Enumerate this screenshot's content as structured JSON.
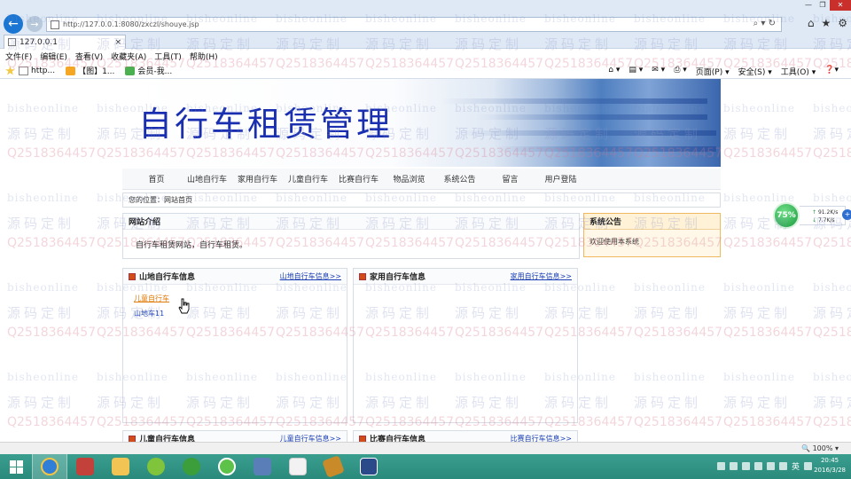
{
  "browser": {
    "address": "http://127.0.0.1:8080/zxczl/shouye.jsp",
    "tab_title": "127.0.0.1",
    "tab_close": "×",
    "menu": [
      "文件(F)",
      "编辑(E)",
      "查看(V)",
      "收藏夹(A)",
      "工具(T)",
      "帮助(H)"
    ],
    "favorites": [
      "http...",
      "【图】1...",
      "会员-我..."
    ],
    "commands": [
      "页面(P) ▾",
      "安全(S) ▾",
      "工具(O) ▾"
    ],
    "window_controls": [
      "—",
      "❐",
      "✕"
    ]
  },
  "site": {
    "title": "自行车租赁管理",
    "nav": [
      "首页",
      "山地自行车",
      "家用自行车",
      "儿童自行车",
      "比赛自行车",
      "物品浏览",
      "系统公告",
      "留言",
      "用户登陆"
    ],
    "breadcrumb": "您的位置：网站首页",
    "intro": {
      "heading": "网站介绍",
      "text": "自行车租赁网站，自行车租赁。"
    },
    "notice": {
      "heading": "系统公告",
      "text": "欢迎使用本系统"
    },
    "panels": {
      "mtb": {
        "heading": "山地自行车信息",
        "more": "山地自行车信息>>",
        "items": [
          "儿童自行车",
          "山地车11"
        ]
      },
      "home": {
        "heading": "家用自行车信息",
        "more": "家用自行车信息>>"
      },
      "kid": {
        "heading": "儿童自行车信息",
        "more": "儿童自行车信息>>"
      },
      "race": {
        "heading": "比赛自行车信息",
        "more": "比赛自行车信息>>"
      }
    }
  },
  "watermark": {
    "text_a": "bisheonline",
    "text_b": "源码定制",
    "text_c": "Q2518364457"
  },
  "network": {
    "percent": "75%",
    "up": "91.2K/s",
    "down": "7.7K/s"
  },
  "status": {
    "zoom": "🔍 100% ▾"
  },
  "taskbar": {
    "time": "20:45",
    "date": "2016/3/28",
    "ime": "英"
  },
  "colors": {
    "title_blue": "#1a2fb0",
    "link_blue": "#1a3fb5",
    "highlight_orange": "#e07b0a",
    "taskbar_teal": "#2a8a7c"
  }
}
